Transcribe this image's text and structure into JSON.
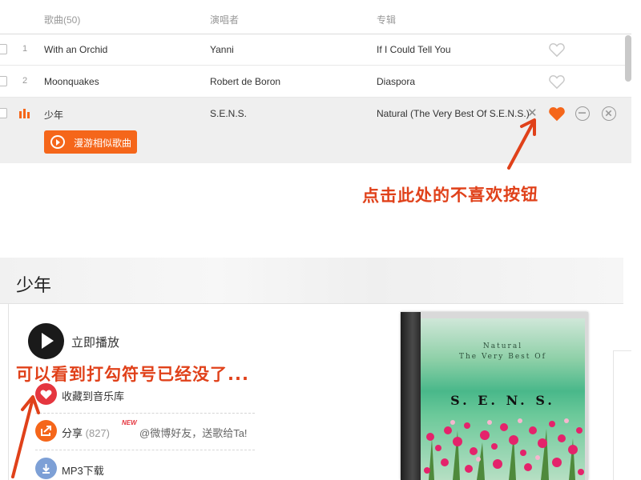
{
  "table": {
    "headers": {
      "song": "歌曲(50)",
      "artist": "演唱者",
      "album": "专辑"
    },
    "rows": [
      {
        "index": "1",
        "title": "With an Orchid",
        "artist": "Yanni",
        "album": "If I Could Tell You"
      },
      {
        "index": "2",
        "title": "Moonquakes",
        "artist": "Robert de Boron",
        "album": "Diaspora"
      },
      {
        "index": "",
        "title": "少年",
        "artist": "S.E.N.S.",
        "album": "Natural (The Very Best Of S.E.N.S.)",
        "x_glyph": "✕",
        "playing": true,
        "liked": true
      }
    ],
    "roam_button": "漫游相似歌曲"
  },
  "annotations": {
    "dislike_hint": "点击此处的不喜欢按钮",
    "check_gone_hint": "可以看到打勾符号已经没了..."
  },
  "detail": {
    "title": "少年",
    "play_label": "立即播放",
    "favorite_label": "收藏到音乐库",
    "share_label": "分享",
    "share_count": "(827)",
    "new_badge": "NEW",
    "weibo_text": "@微博好友，送歌给Ta!",
    "download_label": "MP3下载",
    "album_art": {
      "line1": "Natural",
      "line2": "The Very Best Of",
      "artist": "S. E. N. S."
    }
  },
  "colors": {
    "accent_orange": "#f5661a",
    "annotation_red": "#e0411a",
    "favorite_red": "#e5363f",
    "download_blue": "#7da0d6"
  },
  "icons": [
    "heart-icon",
    "playing-bars-icon",
    "close-icon",
    "more-icon",
    "remove-icon",
    "radio-icon",
    "play-icon",
    "share-icon",
    "download-icon",
    "arrow-icon"
  ]
}
